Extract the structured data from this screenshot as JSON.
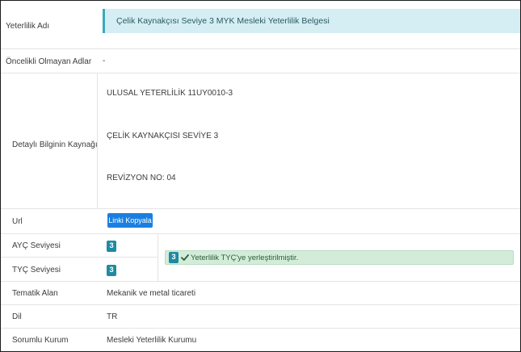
{
  "qualification_name": {
    "label": "Yeterlilik Adı",
    "value": "Çelik Kaynakçısı Seviye 3 MYK Mesleki Yeterlilik Belgesi"
  },
  "non_preferred_names": {
    "label": "Öncelikli Olmayan Adlar",
    "value": "-"
  },
  "detailed_source": {
    "label": "Detaylı Bilginin Kaynağı",
    "lines": [
      "ULUSAL YETERLİLİK 11UY0010-3",
      "ÇELİK KAYNAKÇISI SEVİYE 3",
      "REVİZYON NO: 04"
    ]
  },
  "url": {
    "label": "Url",
    "copy_button": "Linki Kopyala"
  },
  "ayc_level": {
    "label": "AYÇ Seviyesi",
    "value": "3"
  },
  "tyc_level": {
    "label": "TYÇ Seviyesi",
    "value": "3"
  },
  "tyc_status": {
    "badge": "3",
    "icon": "check-icon",
    "text": "Yeterlilik TYÇ'ye yerleştirilmiştir."
  },
  "thematic_area": {
    "label": "Tematik Alan",
    "value": "Mekanik ve metal ticareti"
  },
  "language": {
    "label": "Dil",
    "value": "TR"
  },
  "responsible_body": {
    "label": "Sorumlu Kurum",
    "value": "Mesleki Yeterlilik Kurumu"
  },
  "colors": {
    "title_bg": "#d4eef3",
    "title_accent": "#3aa9bd",
    "button": "#1a7fe0",
    "badge": "#1f8aa0",
    "success_bg": "#d3ecd9"
  }
}
